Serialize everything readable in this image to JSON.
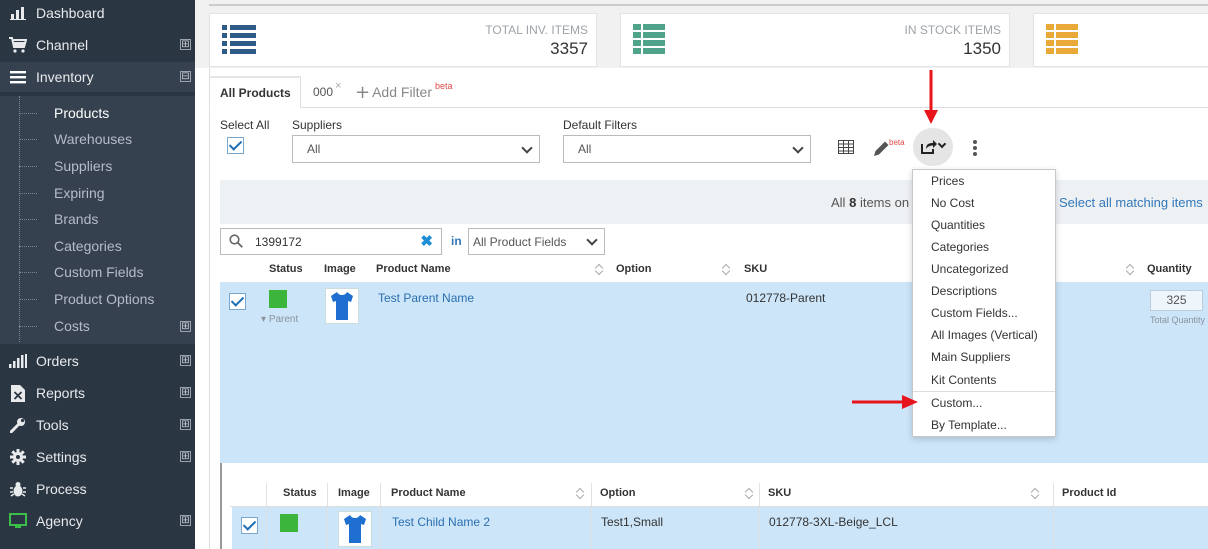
{
  "sidebar": {
    "items": [
      {
        "label": "Dashboard",
        "icon": "bar-chart-icon"
      },
      {
        "label": "Channel",
        "icon": "cart-icon",
        "expander": "⊞"
      },
      {
        "label": "Inventory",
        "icon": "list-icon",
        "expander": "⊟"
      },
      {
        "label": "Orders",
        "icon": "signal-icon",
        "expander": "⊞"
      },
      {
        "label": "Reports",
        "icon": "excel-file-icon",
        "expander": "⊞"
      },
      {
        "label": "Tools",
        "icon": "wrench-icon",
        "expander": "⊞"
      },
      {
        "label": "Settings",
        "icon": "gear-icon",
        "expander": "⊞"
      },
      {
        "label": "Process",
        "icon": "bug-icon"
      },
      {
        "label": "Agency",
        "icon": "monitor-icon",
        "expander": "⊞"
      }
    ],
    "inventory_sub": [
      {
        "label": "Products"
      },
      {
        "label": "Warehouses"
      },
      {
        "label": "Suppliers"
      },
      {
        "label": "Expiring"
      },
      {
        "label": "Brands"
      },
      {
        "label": "Categories"
      },
      {
        "label": "Custom Fields"
      },
      {
        "label": "Product Options"
      },
      {
        "label": "Costs",
        "expander": "⊞"
      }
    ]
  },
  "stats": [
    {
      "label": "TOTAL INV. ITEMS",
      "value": "3357",
      "color": "#2f5b87"
    },
    {
      "label": "IN STOCK ITEMS",
      "value": "1350",
      "color": "#4fa38a"
    },
    {
      "label": "",
      "value": "",
      "color": "#e9a83a"
    }
  ],
  "tabs": {
    "active": "All Products",
    "saved": "000",
    "close": "×",
    "add_filter": "Add Filter",
    "add_filter_badge": "beta"
  },
  "filters": {
    "select_all_label": "Select All",
    "suppliers_label": "Suppliers",
    "suppliers_value": "All",
    "default_filters_label": "Default Filters",
    "default_filters_value": "All",
    "edit_badge": "beta"
  },
  "info": {
    "prefix": "All",
    "count": "8",
    "suffix": "items on",
    "select_all_matching": "Select all matching items"
  },
  "search": {
    "value": "1399172",
    "in_label": "in",
    "field_select": "All Product Fields"
  },
  "table": {
    "headers": {
      "status": "Status",
      "image": "Image",
      "product_name": "Product Name",
      "option": "Option",
      "sku": "SKU",
      "quantity": "Quantity"
    },
    "parent": {
      "name": "Test Parent Name",
      "sku": "012778-Parent",
      "tag": "Parent",
      "quantity": "325",
      "quantity_label": "Total Quantity"
    },
    "child_headers": {
      "status": "Status",
      "image": "Image",
      "product_name": "Product Name",
      "option": "Option",
      "sku": "SKU",
      "product_id": "Product Id"
    },
    "child": {
      "name": "Test Child Name 2",
      "option": "Test1,Small",
      "sku": "012778-3XL-Beige_LCL"
    }
  },
  "export_menu": {
    "items": [
      "Prices",
      "No Cost",
      "Quantities",
      "Categories",
      "Uncategorized",
      "Descriptions",
      "Custom Fields...",
      "All Images (Vertical)",
      "Main Suppliers",
      "Kit Contents",
      "Custom...",
      "By Template..."
    ]
  },
  "colors": {
    "sidebar": "#2b3643",
    "accent": "#3378b8",
    "selected_row": "#cde5f8",
    "status_green": "#3bb53b",
    "annotation_arrow": "#e8141b"
  }
}
